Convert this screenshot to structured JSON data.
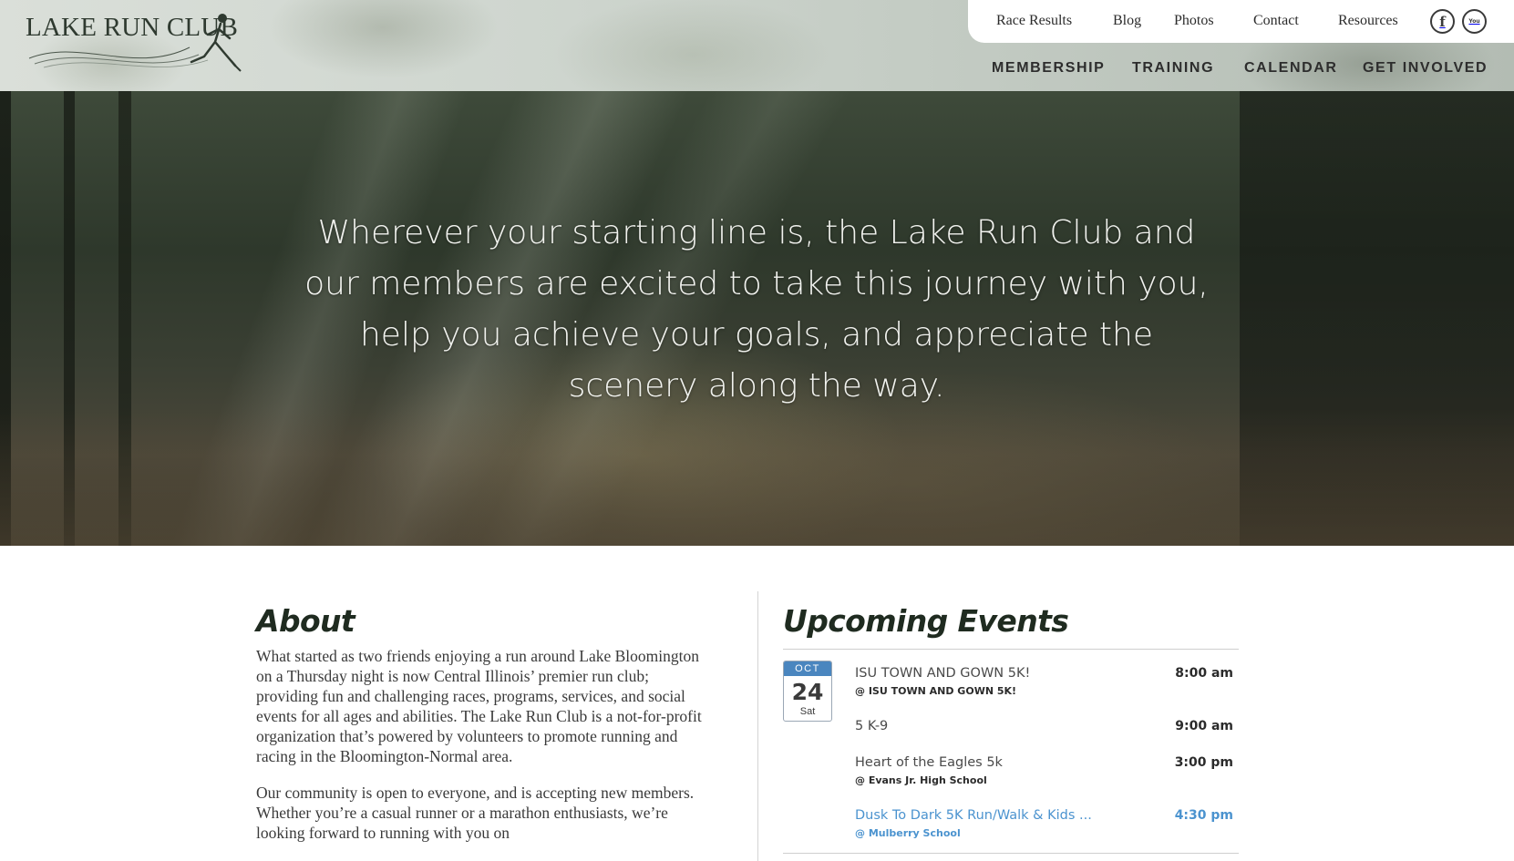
{
  "header": {
    "logo_text": "LAKE RUN CLUB",
    "utility_links": [
      {
        "label": "Race Results"
      },
      {
        "label": "Blog"
      },
      {
        "label": "Photos"
      },
      {
        "label": "Contact"
      },
      {
        "label": "Resources"
      }
    ],
    "social": [
      {
        "icon": "facebook-icon",
        "glyph": "f"
      },
      {
        "icon": "youtube-icon",
        "glyph": "You"
      }
    ],
    "main_nav": [
      {
        "label": "MEMBERSHIP"
      },
      {
        "label": "TRAINING"
      },
      {
        "label": "CALENDAR"
      },
      {
        "label": "GET INVOLVED"
      }
    ]
  },
  "hero": {
    "tagline": "Wherever your starting line is, the Lake Run Club and our members are excited to take this journey with you, help you achieve your goals, and appreciate the scenery along the way."
  },
  "about": {
    "title": "About",
    "paragraphs": [
      "What started as two friends enjoying a run around Lake Bloomington on a Thursday night is now Central Illinois’ premier run club; providing fun and challenging races, programs, services, and social events for all ages and abilities. The Lake Run Club is a not-for-profit organization that’s powered by volunteers to promote running and racing in the Bloomington-Normal area.",
      "Our community is open to everyone, and is accepting new members. Whether you’re a casual runner or a marathon enthusiasts, we’re looking forward to running with you on"
    ]
  },
  "events": {
    "title": "Upcoming Events",
    "date": {
      "month": "OCT",
      "day": "24",
      "weekday": "Sat"
    },
    "items": [
      {
        "name": "ISU TOWN AND GOWN 5K!",
        "venue": "@ ISU TOWN AND GOWN 5K!",
        "time": "8:00 am"
      },
      {
        "name": "5 K-9",
        "venue": "",
        "time": "9:00 am"
      },
      {
        "name": "Heart of the Eagles 5k",
        "venue": "@ Evans Jr. High School",
        "time": "3:00 pm"
      },
      {
        "name": "Dusk To Dark 5K Run/Walk & Kids ...",
        "venue": "@ Mulberry School",
        "time": "4:30 pm"
      }
    ]
  },
  "colors": {
    "accent_blue": "#4b93cf",
    "date_header": "#4a86bf",
    "logo_green": "#2f3a30"
  }
}
